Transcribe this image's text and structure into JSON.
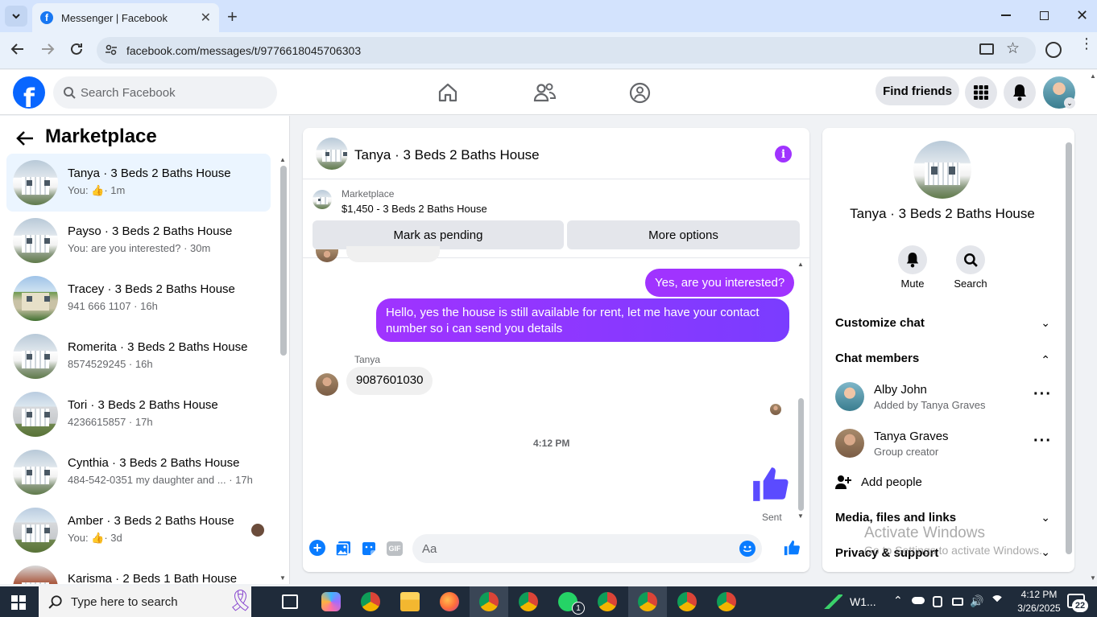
{
  "browser": {
    "tab_title": "Messenger | Facebook",
    "url": "facebook.com/messages/t/9776618045706303"
  },
  "header": {
    "search_placeholder": "Search Facebook",
    "find_friends": "Find friends"
  },
  "left_panel": {
    "title": "Marketplace",
    "conversations": [
      {
        "name": "Tanya · 3 Beds 2 Baths House",
        "snippet_pre": "You: ",
        "snippet": "· 1m",
        "like": true
      },
      {
        "name": "Payso · 3 Beds 2 Baths House",
        "snippet": "You: are you interested? · 30m"
      },
      {
        "name": "Tracey · 3 Beds 2 Baths House",
        "snippet": "941 666 1107 · 16h"
      },
      {
        "name": "Romerita · 3 Beds 2 Baths House",
        "snippet": "8574529245 · 16h"
      },
      {
        "name": "Tori · 3 Beds 2 Baths House",
        "snippet": "4236615857 · 17h"
      },
      {
        "name": "Cynthia · 3 Beds 2 Baths House",
        "snippet": "484-542-0351 my daughter and ...   · 17h"
      },
      {
        "name": "Amber · 3 Beds 2 Baths House",
        "snippet_pre": "You: ",
        "snippet": "· 3d",
        "like": true
      },
      {
        "name": "Karisma · 2 Beds 1 Bath House",
        "snippet": ""
      }
    ]
  },
  "chat": {
    "title": "Tanya · 3 Beds 2 Baths House",
    "listing_label": "Marketplace",
    "listing_price": "$1,450 - 3 Beds 2 Baths House",
    "mark_pending": "Mark as pending",
    "more_options": "More options",
    "messages": {
      "out1": "Yes, are you interested?",
      "out2": "Hello, yes the house is still available for rent, let me have your contact number so i can send you  details",
      "sender": "Tanya",
      "in1": "9087601030",
      "time": "4:12 PM",
      "sent": "Sent"
    },
    "composer_placeholder": "Aa"
  },
  "right_panel": {
    "title": "Tanya · 3 Beds 2 Baths House",
    "mute": "Mute",
    "search": "Search",
    "customize": "Customize chat",
    "members_title": "Chat members",
    "members": [
      {
        "name": "Alby John",
        "sub": "Added by Tanya Graves"
      },
      {
        "name": "Tanya Graves",
        "sub": "Group creator"
      }
    ],
    "add_people": "Add people",
    "media": "Media, files and links",
    "privacy": "Privacy & support"
  },
  "watermark": {
    "line1": "Activate Windows",
    "line2": "Go to Settings to activate Windows."
  },
  "taskbar": {
    "search_placeholder": "Type here to search",
    "weather": "W1...",
    "time": "4:12 PM",
    "date": "3/26/2025",
    "notifications": "22",
    "whatsapp_badge": "1"
  },
  "colors": {
    "fb_blue": "#0866ff",
    "messenger_purple": "#a033ff",
    "like_blue": "#0a7cff"
  }
}
